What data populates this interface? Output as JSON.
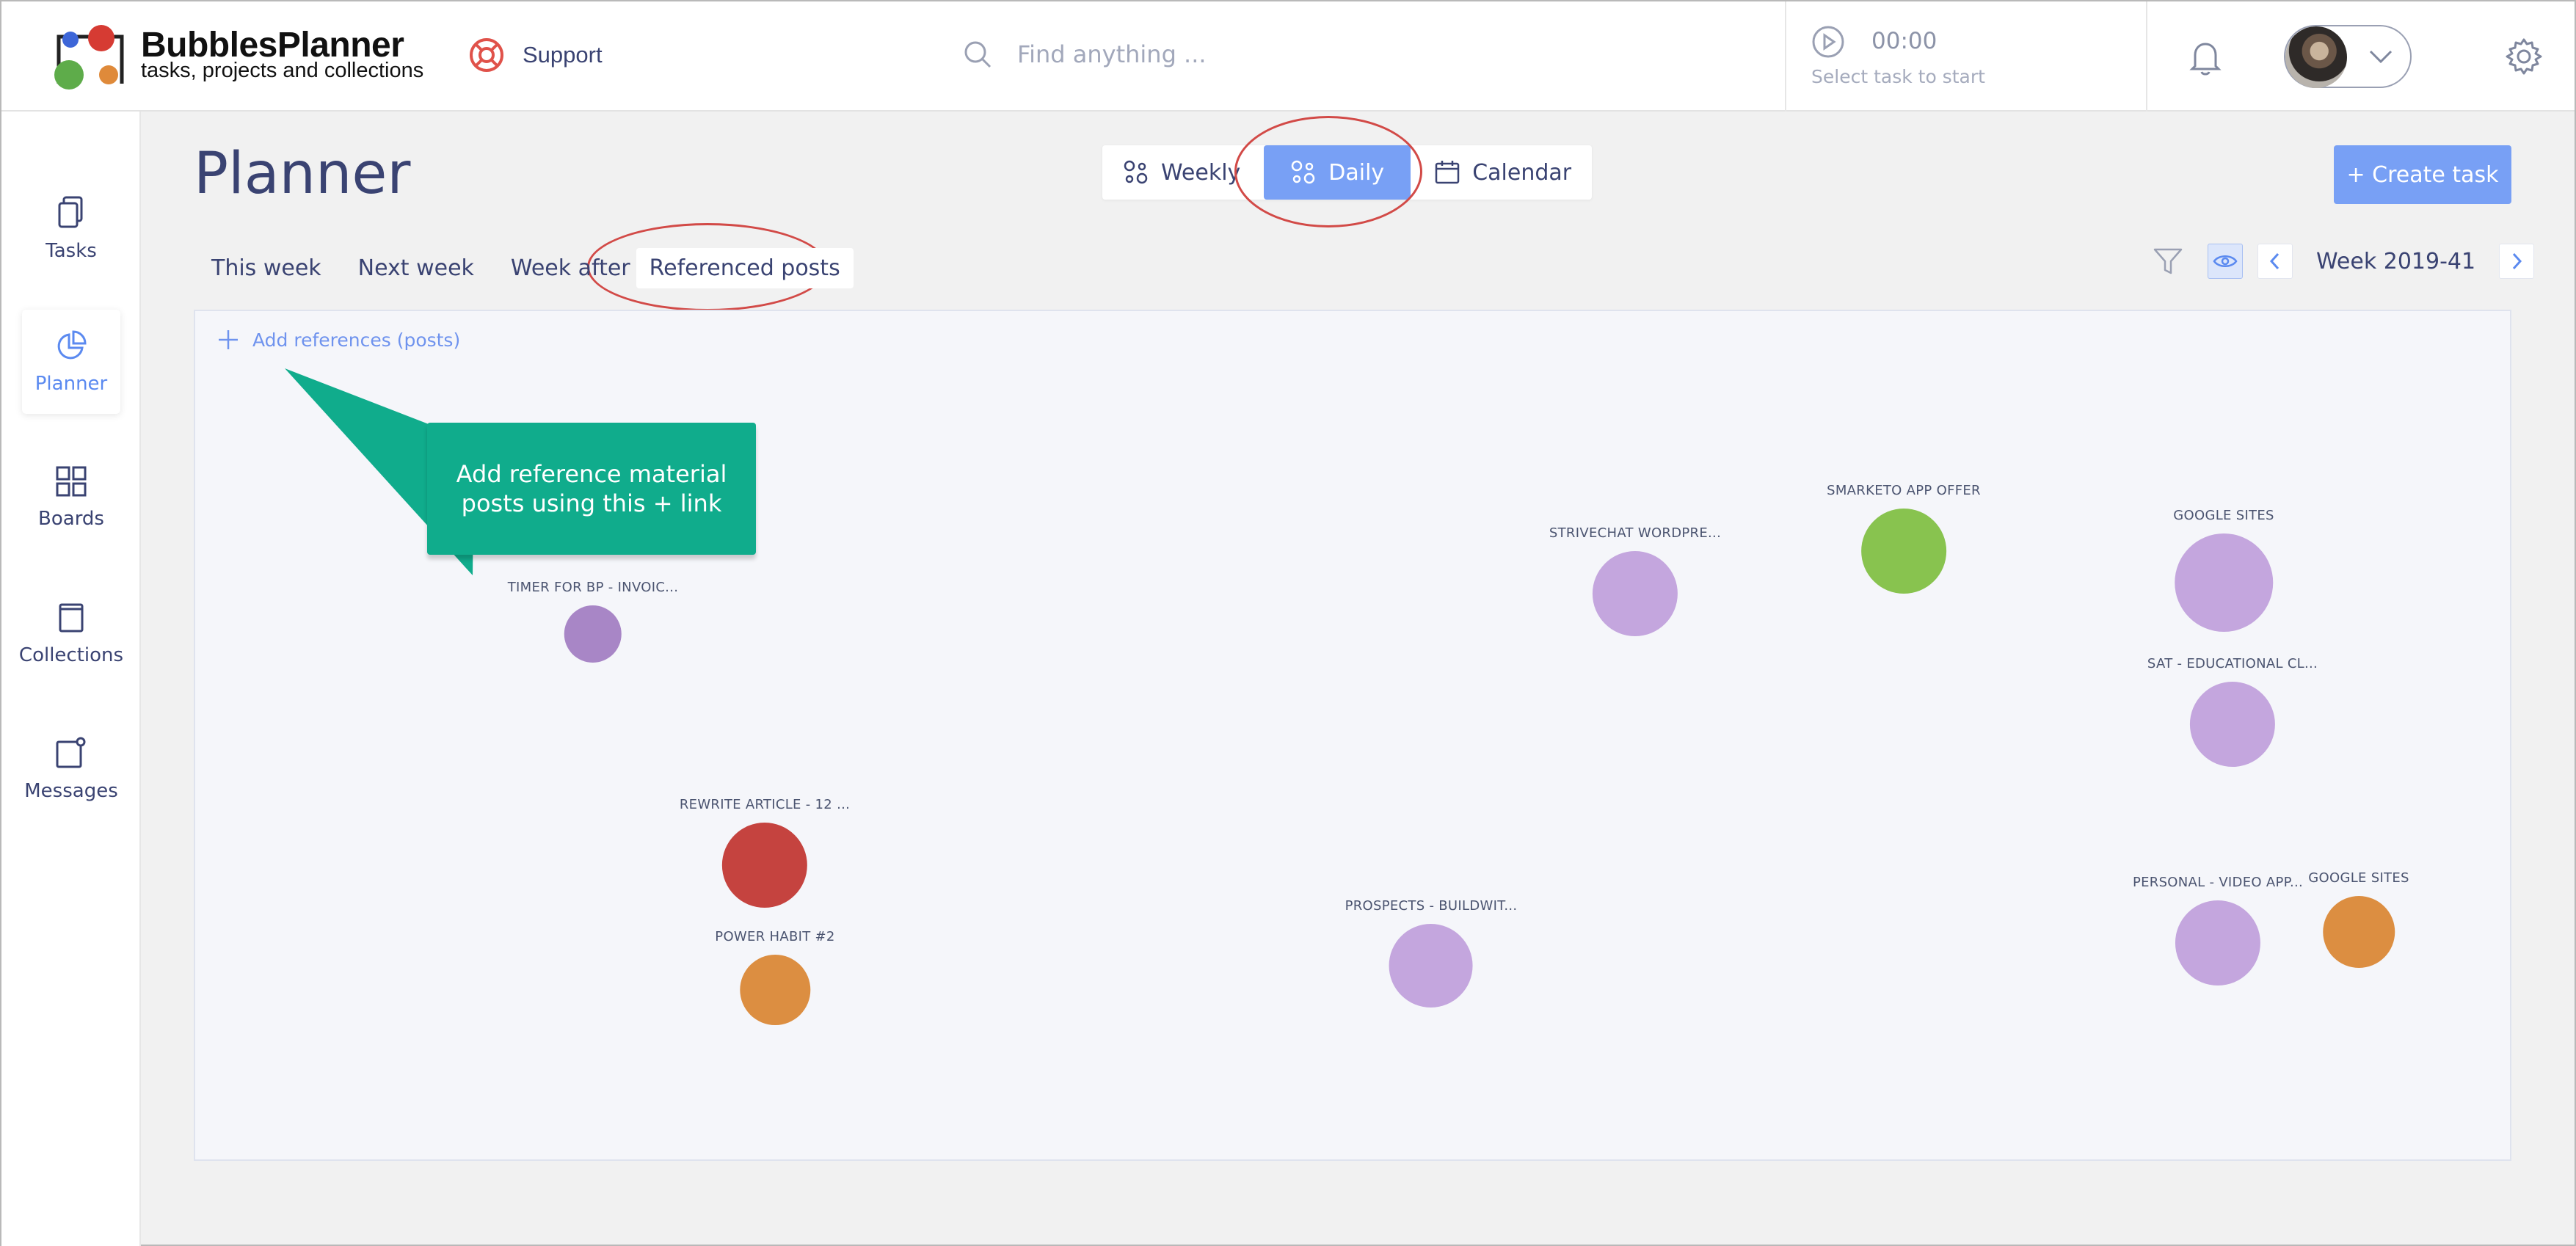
{
  "header": {
    "brand_name": "BubblesPlanner",
    "brand_tagline": "tasks, projects and collections",
    "support_label": "Support",
    "search_placeholder": "Find anything ...",
    "timer_time": "00:00",
    "timer_hint": "Select task to start"
  },
  "sidebar": {
    "items": [
      {
        "label": "Tasks",
        "icon": "copy-icon"
      },
      {
        "label": "Planner",
        "icon": "pie-chart-icon"
      },
      {
        "label": "Boards",
        "icon": "grid-icon"
      },
      {
        "label": "Collections",
        "icon": "book-icon"
      },
      {
        "label": "Messages",
        "icon": "message-icon"
      }
    ],
    "active": "Planner"
  },
  "main": {
    "title": "Planner",
    "views": [
      {
        "label": "Weekly",
        "icon": "bubbles-icon"
      },
      {
        "label": "Daily",
        "icon": "bubbles-icon"
      },
      {
        "label": "Calendar",
        "icon": "calendar-icon"
      }
    ],
    "active_view": "Daily",
    "create_label": "+ Create task",
    "tabs": [
      {
        "label": "This week"
      },
      {
        "label": "Next week"
      },
      {
        "label": "Week after"
      },
      {
        "label": "Referenced posts"
      }
    ],
    "active_tab": "Referenced posts",
    "week_label": "Week 2019-41",
    "add_references_label": "Add references (posts)",
    "callout_text": "Add reference material posts using this + link"
  },
  "colors": {
    "accent": "#78a0f5",
    "callout": "#10ac8c",
    "highlight_ring": "#d24a47",
    "purple": "#c4a6de",
    "dark_purple": "#a886c6",
    "red": "#c5433f",
    "orange": "#dc8e41",
    "green": "#88c34f"
  },
  "bubbles": [
    {
      "label": "TIMER FOR BP - INVOIC...",
      "color": "#a886c6"
    },
    {
      "label": "REWRITE ARTICLE - 12 ...",
      "color": "#c5433f"
    },
    {
      "label": "POWER HABIT #2",
      "color": "#dc8e41"
    },
    {
      "label": "PROSPECTS - BUILDWIT...",
      "color": "#c4a6de"
    },
    {
      "label": "STRIVECHAT WORDPRE...",
      "color": "#c4a6de"
    },
    {
      "label": "SMARKETO APP OFFER",
      "color": "#88c34f"
    },
    {
      "label": "GOOGLE SITES",
      "color": "#c4a6de"
    },
    {
      "label": "SAT - EDUCATIONAL CL...",
      "color": "#c4a6de"
    },
    {
      "label": "PERSONAL - VIDEO APP...",
      "color": "#c4a6de"
    },
    {
      "label": "GOOGLE SITES",
      "color": "#dc8e41"
    }
  ]
}
